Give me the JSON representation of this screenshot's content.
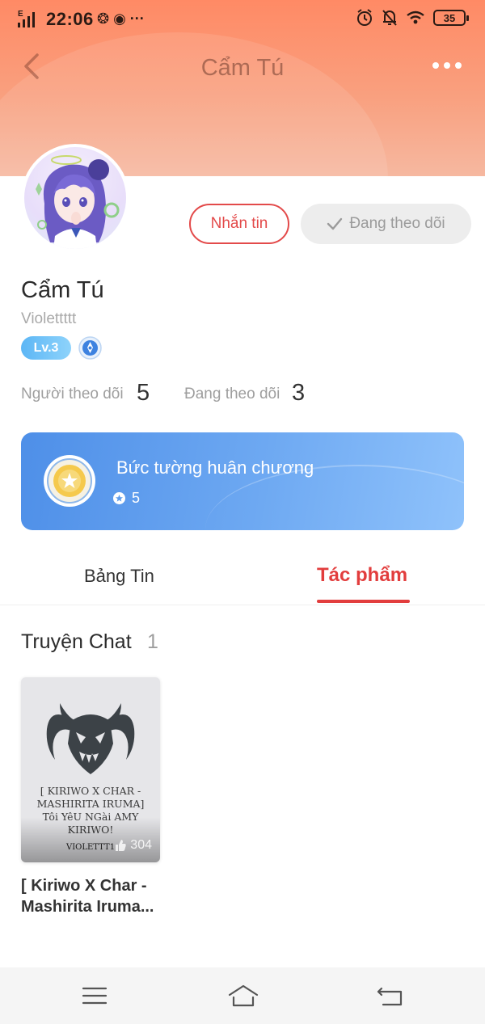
{
  "status_bar": {
    "network": "E",
    "time": "22:06",
    "notification_icons": "❂ ◉ ···",
    "battery": "35"
  },
  "nav": {
    "title": "Cẩm Tú"
  },
  "profile": {
    "name": "Cẩm Tú",
    "username": "Violettttt",
    "level": "Lv.3",
    "message_button": "Nhắn tin",
    "following_button": "Đang theo dõi",
    "followers_label": "Người theo dõi",
    "followers_count": "5",
    "following_label": "Đang theo dõi",
    "following_count": "3"
  },
  "medal_wall": {
    "title": "Bức tường huân chương",
    "count": "5"
  },
  "tabs": [
    {
      "label": "Bảng Tin",
      "active": false
    },
    {
      "label": "Tác phẩm",
      "active": true
    }
  ],
  "section": {
    "title": "Truyện Chat",
    "count": "1"
  },
  "stories": [
    {
      "cover_text": "[ KIRIWO X CHAR - MASHIRITA IRUMA] Tôi YêU NGài AMY KIRIWO!",
      "cover_author": "VIOLETTT1",
      "likes": "304",
      "title": "[ Kiriwo X Char - Mashirita Iruma..."
    }
  ],
  "colors": {
    "accent": "#e23d3d",
    "header_gradient_top": "#ff8a65",
    "medal_card": "#5f9ded",
    "level_badge": "#5cb6f5"
  }
}
